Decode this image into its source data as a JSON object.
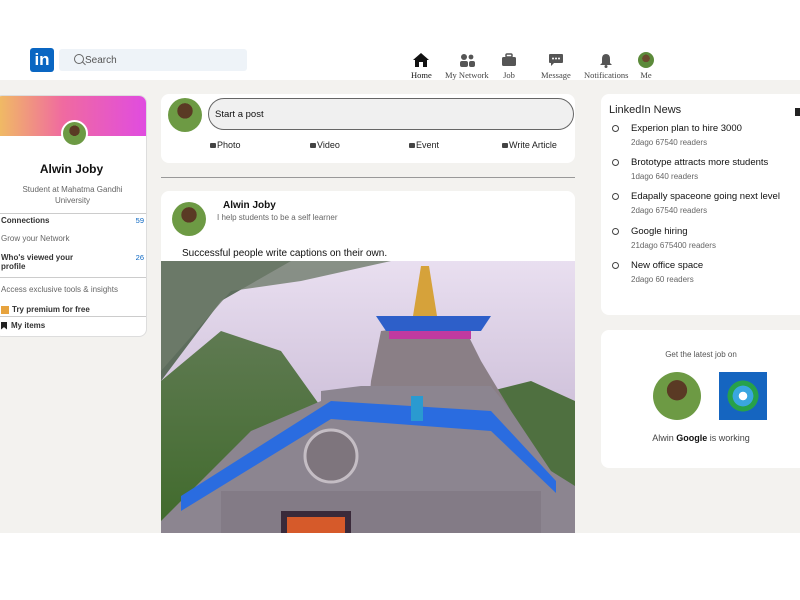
{
  "header": {
    "logo_text": "in",
    "search_placeholder": "Search",
    "nav": [
      {
        "label": "Home",
        "icon": "home-icon"
      },
      {
        "label": "My Network",
        "icon": "network-icon"
      },
      {
        "label": "Job",
        "icon": "briefcase-icon"
      },
      {
        "label": "Message",
        "icon": "message-icon"
      },
      {
        "label": "Notifications",
        "icon": "bell-icon"
      },
      {
        "label": "Me",
        "icon": "avatar"
      }
    ]
  },
  "profile": {
    "name": "Alwin Joby",
    "description": "Student at Mahatma Gandhi University",
    "connections_label": "Connections",
    "connections_count": "59",
    "grow_network": "Grow your Network",
    "viewed_label": "Who's viewed your profile",
    "viewed_count": "26",
    "access_text": "Access exclusive tools & insights",
    "premium_label": "Try premium for free",
    "my_items_label": "My items"
  },
  "composer": {
    "placeholder": "Start a post",
    "actions": [
      "Photo",
      "Video",
      "Event",
      "Write Article"
    ]
  },
  "post": {
    "author": "Alwin Joby",
    "headline": "I help students to be a self learner",
    "caption": "Successful people write captions on their own."
  },
  "news": {
    "title": "LinkedIn News",
    "items": [
      {
        "title": "Experion plan to hire 3000",
        "meta": "2dago 67540 readers"
      },
      {
        "title": "Brototype attracts more students",
        "meta": "1dago 640 readers"
      },
      {
        "title": "Edapally spaceone going next level",
        "meta": "2dago 67540 readers"
      },
      {
        "title": "Google hiring",
        "meta": "21dago 675400 readers"
      },
      {
        "title": "New office space",
        "meta": "2dago 60 readers"
      }
    ]
  },
  "jobs": {
    "title": "Get the latest job on",
    "line_prefix": "Alwin",
    "line_company": "Google",
    "line_suffix": "is working"
  },
  "colors": {
    "brand": "#0a66c2",
    "background": "#f3f2ef"
  }
}
